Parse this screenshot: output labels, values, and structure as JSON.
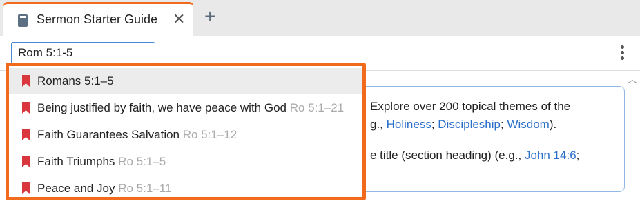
{
  "tab": {
    "title": "Sermon Starter Guide",
    "close": "✕",
    "new_tab": "+"
  },
  "toolbar": {
    "reference_value": "Rom 5:1-5"
  },
  "panel": {
    "line1_text": "Explore over 200 topical themes of the",
    "line2_prefix": "g., ",
    "links": [
      "Holiness",
      "Discipleship",
      "Wisdom"
    ],
    "line2_end": ").",
    "line3_text": "e title (section heading) (e.g., ",
    "line3_link": "John 14:6",
    "line3_end": ";"
  },
  "dropdown": {
    "items": [
      {
        "label": "Romans 5:1–5",
        "ref": ""
      },
      {
        "label": "Being justified by faith, we have peace with God",
        "ref": "Ro 5:1–21"
      },
      {
        "label": "Faith Guarantees Salvation",
        "ref": "Ro 5:1–12"
      },
      {
        "label": "Faith Triumphs",
        "ref": "Ro 5:1–5"
      },
      {
        "label": "Peace and Joy",
        "ref": "Ro 5:1–11"
      }
    ]
  },
  "colors": {
    "accent": "#f26a1b",
    "link": "#2a6fc9",
    "bookmark": "#d9363e"
  }
}
